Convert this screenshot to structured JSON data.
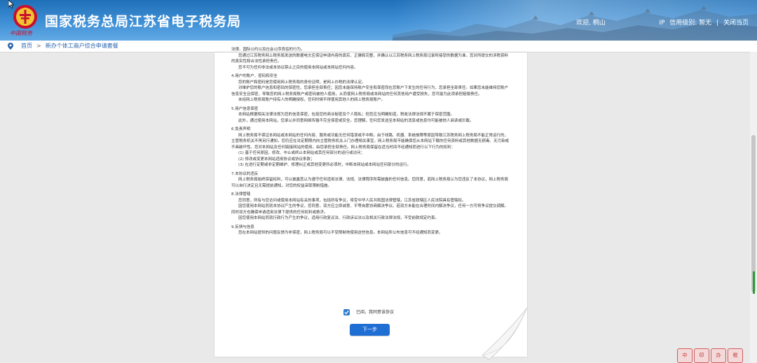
{
  "header": {
    "title": "国家税务总局江苏省电子税务局",
    "emblem_caption": "中国税务",
    "welcome": "欢迎, 桐山",
    "user_links": [
      "IP",
      "信用级别: 暂无",
      "关闭当页"
    ],
    "separator": "|"
  },
  "breadcrumb": {
    "home": "首页",
    "separator": ">",
    "current": "新办个体工商户综合申请套餐"
  },
  "agreement": {
    "top_lines": [
      "法律、国际公约以及社会公序良俗的行为。",
      "您通过江苏税务网上税务局发送的数据电文应保证申请内容的真实、正确和完整，并确认以江苏税务网上税务局记录所接受的数据为准。您对所提交的涉税资料的真实性和合法性承担责任。",
      "您不可为任何非法或本协议禁止之目的使用本网站或本网站任何内容。"
    ],
    "sections": [
      {
        "heading": "4.用户的账户、密码和安全",
        "lines": [
          "您的账户和密码是您使用网上税务局的身份证明，是网上办税的法律认定。",
          "对维护您的账户信息和密码的保密性，您承担全部责任；因您未能保持账户安全和保密而在您账户下发生的任何行为，您承担全部责任。如果您未能维持您账户信息安全且保密，导致您的网上税务局账户或密码被他人使用，从而使网上税务局或本网站的任何其他用户遭受损失，您可能为此须承担赔偿责任。",
          "未经网上税务局账户持有人的明确授权，任何时候不得使用其他人的网上税务局账户。"
        ]
      },
      {
        "heading": "5.用户信息保密",
        "lines": [
          "本网站根据相关法律法规为您的信息保密，包括您的商业秘密及个人隐私；但您应当明确知道，税收法律法规不属于保密范围。",
          "此外，通过使用本网站，您承认并同意网络传输不完全保密或安全。您理解，任何您发送至本网站的消息或信息均可能被他人阅读或拦截。"
        ]
      },
      {
        "heading": "6.免责声明",
        "lines": [
          "网上税务局不保证本网站或本网站的任何内容、服务或功能无任何错误或不中断。由于线路、机器、系统故障等原因导致江苏税务网上税务局不能正常运行的，主管税务机关不再另行通知，您仍应在法定期限内向主管税务机关上门办理相关事宜。网上税务局不能确保您从本网站下载的任何资料或其他数据无病毒、无污染或不具破坏性。您对本网站及任何链接网站的使用，由您承担全部责任。网上税务局保留在适当时间不经通知而进行以下行为的权利："
        ],
        "items": [
          "(1) 基于任何原因，修改、中止或终止本网站或其任何部分的运行或访问；",
          "(2) 修改或变更本网站适用协议或协议条款；",
          "(3) 在进行定期或非定期维护、修理纠正或其他变更所必须时，中断本网站或本网站任何部分的运行。"
        ]
      },
      {
        "heading": "7.本协议的违反",
        "lines": [
          "网上税务局始终保留权利，可以披露其认为遵守任何适用法律、法规、法律程序所需披露的任何信息。您同意，若网上税务局认为您违反了本协议，网上税务局可以自行决定且无需提前通知，对您的权益采取限制措施。"
        ]
      },
      {
        "heading": "8.法律管辖",
        "lines": [
          "您同意，所有与您访问或使用本网站有关的事项，包括所有争议，将受中华人民共和国法律管辖，江苏省政辖区人民法院具有管辖权。",
          "因您使用本网站而就本协议产生的争议，您同意，双方应立即诚意、平等自愿协商解决争议。若双方未能在合理时间内解决争议，任何一方可将争议提交调解。同时双方也确保申请适用法律下提供的任何权利或救济。",
          "因您使用本网站而就行政行为产生的争议，适用行政复议法、行政诉讼法以及相关行政法律法规，不受前款规定约束。"
        ]
      },
      {
        "heading": "9.反馈与信息",
        "lines": [
          "您在本网站提供的问题反馈为非保密，网上税务局可以不受限制地使用这些信息。本网站所公布信息可不经通知而变更。"
        ]
      }
    ]
  },
  "agree_checkbox": {
    "label": "已阅，我同意该协议",
    "checked": true
  },
  "next_button": {
    "label": "下一步"
  },
  "stamps": [
    "中",
    "印",
    "办",
    "税"
  ],
  "colors": {
    "header_blue": "#1f6fb8",
    "primary_button": "#1f6ed4",
    "emblem_red": "#c8102e"
  },
  "icons": {
    "location": "location-pin-icon",
    "checkbox": "checkmark-icon",
    "emblem": "tax-emblem-icon",
    "cursor": "mouse-cursor-icon"
  }
}
